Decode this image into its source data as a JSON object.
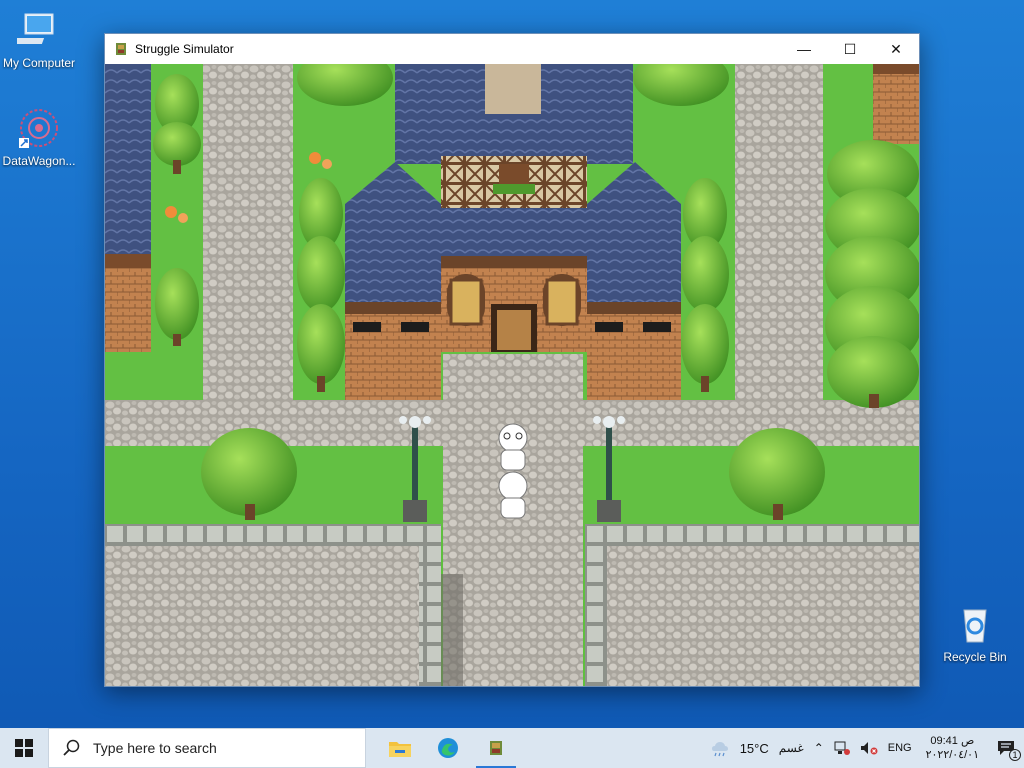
{
  "desktop": {
    "icons": [
      {
        "label": "My Computer"
      },
      {
        "label": "DataWagon..."
      },
      {
        "label": "Recycle Bin"
      }
    ]
  },
  "window": {
    "title": "Struggle Simulator",
    "controls": {
      "minimize": "—",
      "maximize": "☐",
      "close": "✕"
    }
  },
  "taskbar": {
    "search_placeholder": "Type here to search",
    "weather": "15°C",
    "weather_desc": "غسم",
    "language": "ENG",
    "time": "09:41 ص",
    "date": "٢٠٢٢/٠٤/٠١",
    "notifications_count": "1"
  },
  "colors": {
    "desktop_bg": "#1566c2",
    "grass": "#5fbf3f",
    "cobblestone": "#b7b3aa",
    "roof": "#4a5d8a",
    "wall": "#b7794a"
  }
}
